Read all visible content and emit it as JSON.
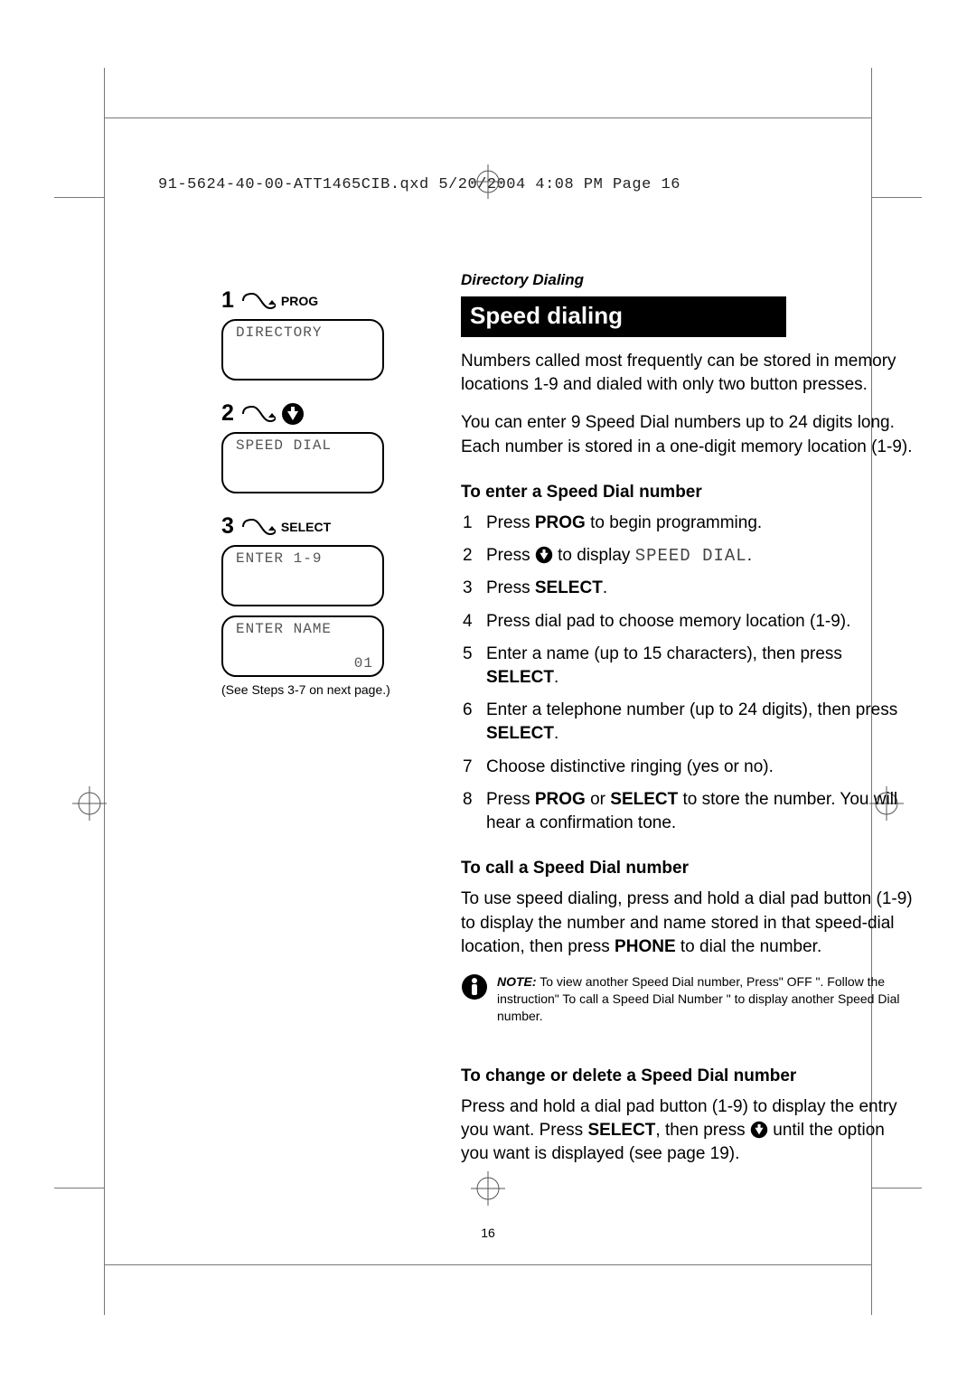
{
  "meta": {
    "print_header": "91-5624-40-00-ATT1465CIB.qxd  5/20/2004  4:08 PM  Page 16"
  },
  "sidebar": {
    "step1": {
      "num": "1",
      "label": "PROG",
      "lcd": "DIRECTORY"
    },
    "step2": {
      "num": "2",
      "lcd": "SPEED DIAL"
    },
    "step3": {
      "num": "3",
      "label": "SELECT",
      "lcd": "ENTER 1-9"
    },
    "step3b": {
      "lcd_line1": "ENTER NAME",
      "lcd_line2": "01"
    },
    "note": "(See Steps 3-7 on next page.)"
  },
  "main": {
    "section_label": "Directory Dialing",
    "title": "Speed dialing",
    "intro1": "Numbers called most frequently can be stored in memory locations 1-9 and dialed with only two button presses.",
    "intro2": "You can enter 9 Speed Dial numbers up to 24 digits long. Each number is stored in a one-digit memory location (1-9).",
    "sub_enter": "To enter a Speed Dial number",
    "step1_a": "Press ",
    "step1_b": "PROG",
    "step1_c": " to begin programming.",
    "step2_a": "Press ",
    "step2_b": " to display ",
    "step2_c": "SPEED DIAL",
    "step2_d": ".",
    "step3_a": "Press ",
    "step3_b": "SELECT",
    "step3_c": ".",
    "step4": "Press dial pad to choose memory location (1-9).",
    "step5_a": "Enter a name (up to 15 characters), then press ",
    "step5_b": "SELECT",
    "step5_c": ".",
    "step6_a": "Enter a telephone number (up to 24 digits), then press ",
    "step6_b": "SELECT",
    "step6_c": ".",
    "step7": "Choose distinctive ringing (yes or no).",
    "step8_a": "Press ",
    "step8_b": "PROG",
    "step8_c": " or ",
    "step8_d": "SELECT",
    "step8_e": " to store the number. You will hear a confirmation tone.",
    "sub_call": "To call a Speed Dial number",
    "call_para_a": "To use speed dialing, press and hold a dial pad button (1-9) to display the number and name stored in that speed-dial location, then press ",
    "call_para_b": "PHONE",
    "call_para_c": " to dial the number.",
    "note_label": "NOTE:",
    "note_body": " To view another Speed Dial number, Press\" OFF \". Follow the instruction\" To call a Speed Dial Number \" to display another Speed Dial number.",
    "sub_change": "To change or delete a Speed Dial number",
    "change_a": "Press and hold a dial pad button (1-9) to display the entry you want. Press ",
    "change_b": "SELECT",
    "change_c": ", then press ",
    "change_d": " until the option you want is displayed (see page 19)."
  },
  "page_number": "16"
}
